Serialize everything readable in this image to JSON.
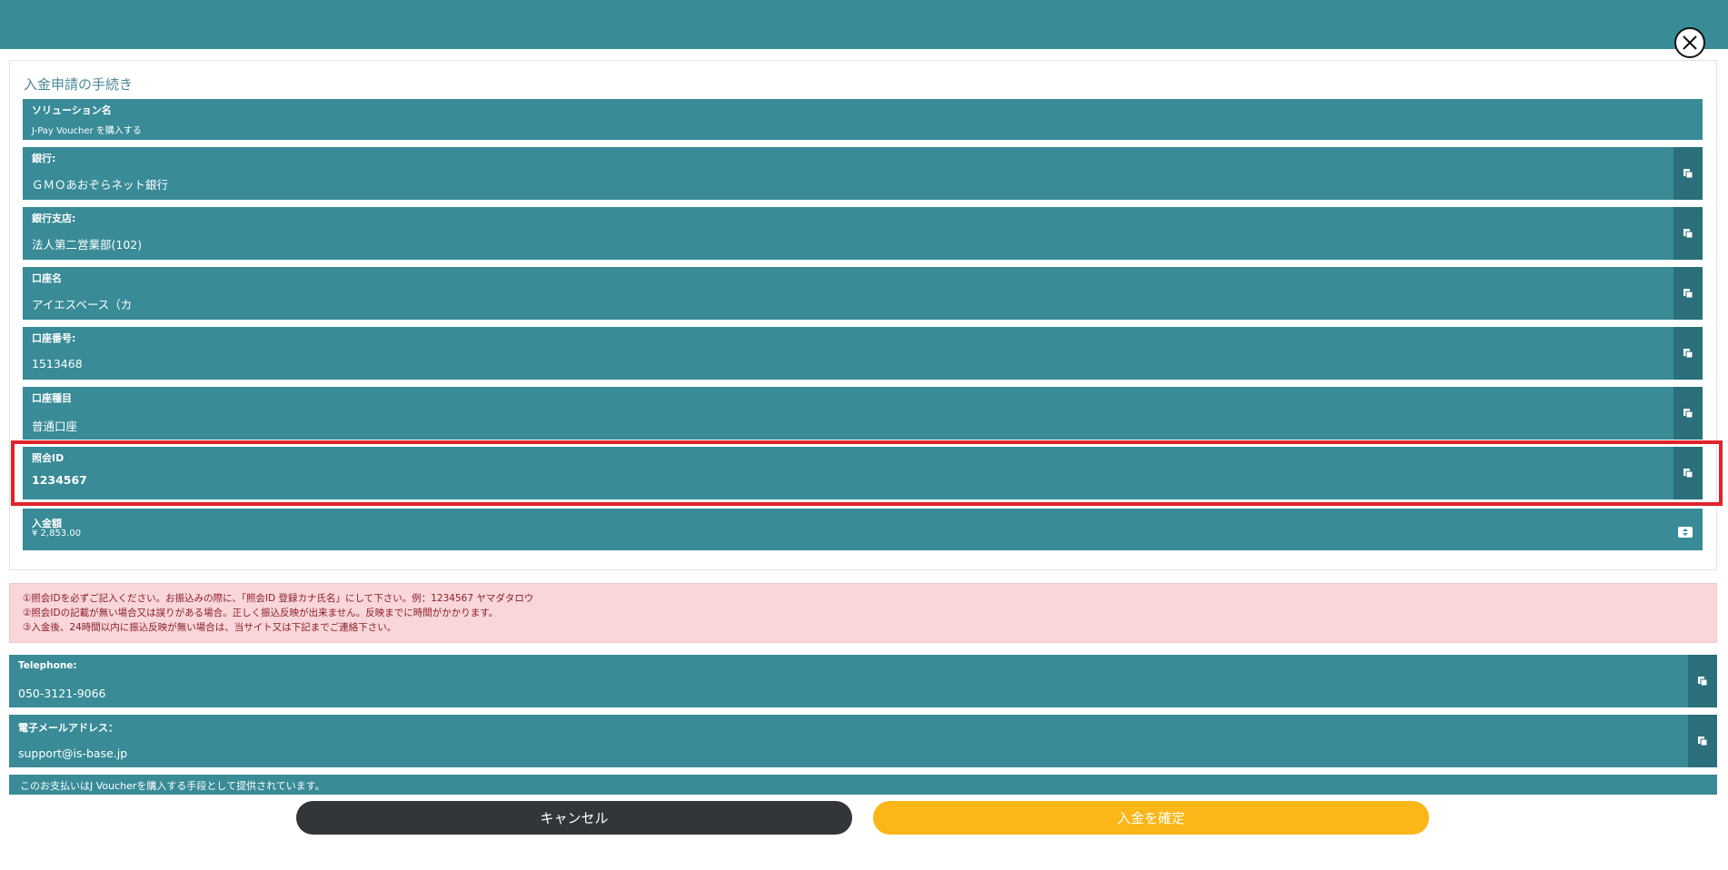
{
  "panel_title": "入金申請の手続き",
  "solution": {
    "label": "ソリューション名",
    "value": "J-Pay Voucher を購入する"
  },
  "fields": [
    {
      "label": "銀行:",
      "value": "ＧＭＯあおぞらネット銀行"
    },
    {
      "label": "銀行支店:",
      "value": "法人第二営業部(102)"
    },
    {
      "label": "口座名",
      "value": "アイエスベース（カ"
    },
    {
      "label": "口座番号:",
      "value": "1513468"
    },
    {
      "label": "口座種目",
      "value": "普通口座"
    },
    {
      "label": "照会ID",
      "value": "1234567"
    }
  ],
  "amount": {
    "label": "入金額",
    "value": "¥ 2,853.00"
  },
  "notice": [
    "①照会IDを必ずご記入ください。お振込みの際に、「照会ID 登録カナ氏名」にして下さい。例：1234567 ヤマダタロウ",
    "②照会IDの記載が無い場合又は誤りがある場合。正しく振込反映が出来ません。反映までに時間がかかります。",
    "③入金後、24時間以内に振込反映が無い場合は、当サイト又は下記までご連絡下さい。"
  ],
  "contacts": [
    {
      "label": "Telephone:",
      "value": "050-3121-9066"
    },
    {
      "label": "電子メールアドレス：",
      "value": "support@is-base.jp"
    }
  ],
  "footer_note": "このお支払いはJ Voucherを購入する手段として提供されています。",
  "buttons": {
    "cancel": "キャンセル",
    "confirm": "入金を確定"
  },
  "colors": {
    "teal": "#388b97",
    "teal_dark": "#2a6f79",
    "highlight": "#e0232b",
    "confirm": "#fbb617",
    "cancel": "#32363b",
    "notice_bg": "#f9d6d9"
  }
}
